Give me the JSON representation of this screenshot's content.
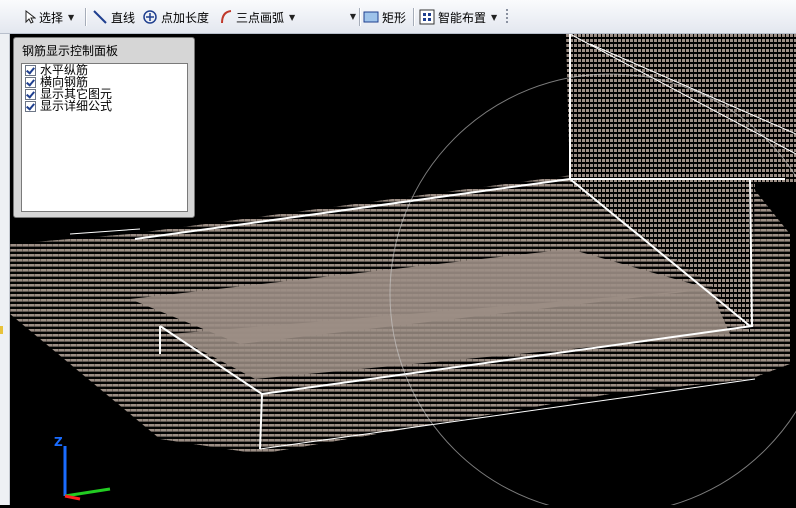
{
  "toolbar": {
    "select_label": "选择",
    "line_label": "直线",
    "point_length_label": "点加长度",
    "arc_label": "三点画弧",
    "combo_value": "",
    "rect_label": "矩形",
    "smart_layout_label": "智能布置"
  },
  "panel": {
    "title": "钢筋显示控制面板",
    "options": [
      {
        "label": "水平纵筋",
        "checked": true
      },
      {
        "label": "横向钢筋",
        "checked": true
      },
      {
        "label": "显示其它图元",
        "checked": true
      },
      {
        "label": "显示详细公式",
        "checked": true
      }
    ]
  },
  "axis": {
    "z_label": "Z"
  },
  "colors": {
    "background": "#000000",
    "rebar": "#9c8e85",
    "outline": "#ffffff",
    "axis_z": "#1a6cff",
    "axis_y": "#22cc22",
    "axis_x": "#ff2020"
  }
}
